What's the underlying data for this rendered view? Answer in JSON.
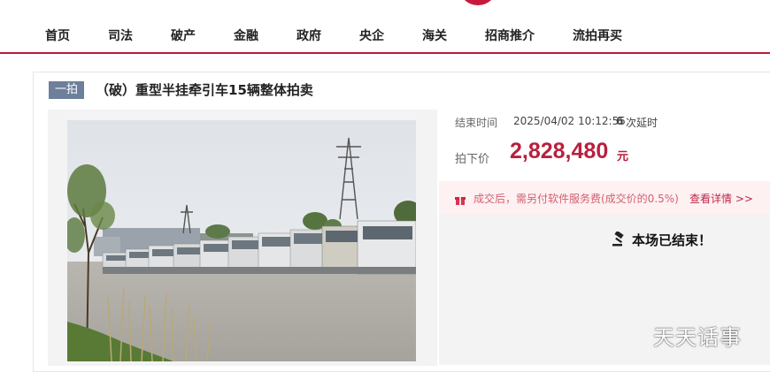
{
  "nav": {
    "items": [
      "首页",
      "司法",
      "破产",
      "金融",
      "政府",
      "央企",
      "海关",
      "招商推介",
      "流拍再买"
    ]
  },
  "auction": {
    "badge": "一拍",
    "title": "（破）重型半挂牵引车15辆整体拍卖",
    "end_time_label": "结束时间",
    "end_time_value": "2025/04/02 10:12:55",
    "delay_count": "6",
    "delay_label": "次延时",
    "price_label": "拍下价",
    "price_value": "2,828,480",
    "price_unit": "元",
    "notice_text": "成交后，需另付软件服务费(成交价的0.5%)",
    "notice_link": "查看详情 >>",
    "status": "本场已结束！"
  },
  "icons": {
    "notice": "gift-icon",
    "status": "gavel-icon"
  },
  "colors": {
    "brand": "#b81a3c",
    "price": "#b8203f",
    "badge": "#6d7f9b"
  },
  "watermark": "天天话事"
}
